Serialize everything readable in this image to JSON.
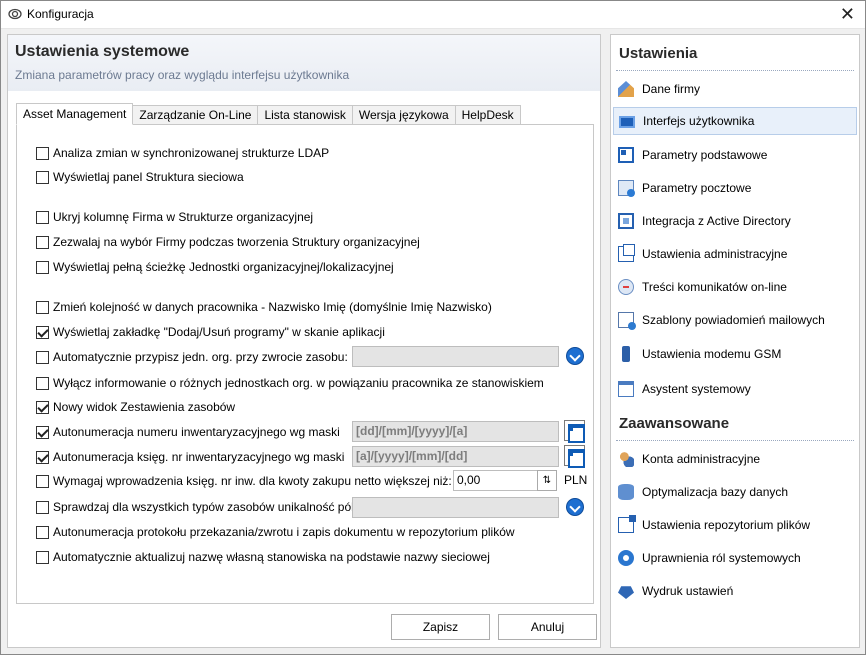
{
  "window": {
    "title": "Konfiguracja",
    "close_glyph": "✕"
  },
  "header": {
    "title": "Ustawienia systemowe",
    "subtitle": "Zmiana parametrów pracy oraz wyglądu interfejsu użytkownika"
  },
  "tabs": [
    {
      "label": "Asset Management",
      "active": true
    },
    {
      "label": "Zarządzanie On-Line",
      "active": false
    },
    {
      "label": "Lista stanowisk",
      "active": false
    },
    {
      "label": "Wersja językowa",
      "active": false
    },
    {
      "label": "HelpDesk",
      "active": false
    }
  ],
  "options": [
    {
      "label": "Analiza zmian w synchronizowanej strukturze LDAP",
      "checked": false
    },
    {
      "label": "Wyświetlaj panel Struktura sieciowa",
      "checked": false
    },
    {
      "label": "Ukryj kolumnę Firma w Strukturze organizacyjnej",
      "checked": false
    },
    {
      "label": "Zezwalaj na wybór Firmy podczas tworzenia Struktury organizacyjnej",
      "checked": false
    },
    {
      "label": "Wyświetlaj pełną ścieżkę Jednostki organizacyjnej/lokalizacyjnej",
      "checked": false
    },
    {
      "label": "Zmień kolejność w danych pracownika - Nazwisko Imię (domyślnie Imię Nazwisko)",
      "checked": false
    },
    {
      "label": "Wyświetlaj zakładkę \"Dodaj/Usuń programy\" w skanie aplikacji",
      "checked": true
    },
    {
      "label": "Automatycznie przypisz jedn. org. przy zwrocie zasobu:",
      "checked": false
    },
    {
      "label": "Wyłącz informowanie o różnych jednostkach org. w powiązaniu pracownika ze stanowiskiem",
      "checked": false
    },
    {
      "label": "Nowy widok Zestawienia zasobów",
      "checked": true
    },
    {
      "label": "Autonumeracja numeru inwentaryzacyjnego wg maski",
      "checked": true
    },
    {
      "label": "Autonumeracja księg. nr inwentaryzacyjnego wg maski",
      "checked": true
    },
    {
      "label": "Wymagaj wprowadzenia księg. nr inw. dla kwoty zakupu netto większej niż:",
      "checked": false
    },
    {
      "label": "Sprawdzaj dla wszystkich typów zasobów unikalność pól",
      "checked": false
    },
    {
      "label": "Autonumeracja protokołu przekazania/zwrotu i zapis dokumentu w repozytorium plików",
      "checked": false
    },
    {
      "label": "Automatycznie aktualizuj nazwę własną stanowiska na podstawie nazwy sieciowej",
      "checked": false
    }
  ],
  "fields": {
    "inv_mask": "[dd]/[mm]/[yyyy]/[a]",
    "book_mask": "[a]/[yyyy]/[mm]/[dd]",
    "amount": "0,00",
    "currency": "PLN",
    "stepper_glyph": "⇅"
  },
  "footer": {
    "save": "Zapisz",
    "cancel": "Anuluj"
  },
  "sidebar": {
    "section1": "Ustawienia",
    "items1": [
      {
        "label": "Dane firmy",
        "icon": "house-icon"
      },
      {
        "label": "Interfejs użytkownika",
        "icon": "monitor-icon",
        "selected": true
      },
      {
        "label": "Parametry podstawowe",
        "icon": "window-icon"
      },
      {
        "label": "Parametry pocztowe",
        "icon": "mail-icon"
      },
      {
        "label": "Integracja z Active Directory",
        "icon": "directory-icon"
      },
      {
        "label": "Ustawienia administracyjne",
        "icon": "admin-icon"
      },
      {
        "label": "Treści komunikatów on-line",
        "icon": "message-icon"
      },
      {
        "label": "Szablony powiadomień mailowych",
        "icon": "template-icon"
      },
      {
        "label": "Ustawienia modemu GSM",
        "icon": "phone-icon"
      },
      {
        "label": "Asystent systemowy",
        "icon": "calendar-icon"
      }
    ],
    "section2": "Zaawansowane",
    "items2": [
      {
        "label": "Konta administracyjne",
        "icon": "users-icon"
      },
      {
        "label": "Optymalizacja bazy danych",
        "icon": "database-icon"
      },
      {
        "label": "Ustawienia repozytorium plików",
        "icon": "repository-icon"
      },
      {
        "label": "Uprawnienia ról systemowych",
        "icon": "role-icon"
      },
      {
        "label": "Wydruk ustawień",
        "icon": "print-icon"
      }
    ]
  },
  "colors": {
    "accent": "#1e6fd1",
    "selected_bg": "#e8f0fa",
    "subtitle": "#6c7a91"
  }
}
